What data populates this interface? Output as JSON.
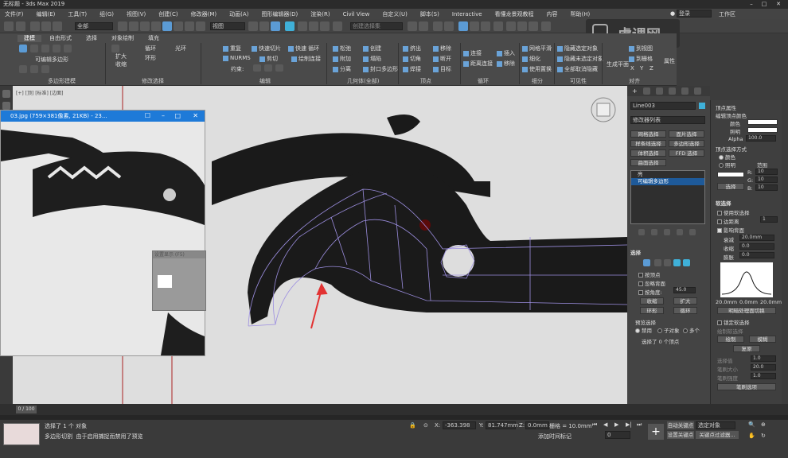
{
  "window": {
    "title": "无标题 - 3ds Max 2019"
  },
  "menu": {
    "items": [
      "文件(F)",
      "编辑(E)",
      "工具(T)",
      "组(G)",
      "视图(V)",
      "创建(C)",
      "修改器(M)",
      "动画(A)",
      "图形编辑器(D)",
      "渲染(R)",
      "Civil View",
      "自定义(U)",
      "脚本(S)",
      "Interactive",
      "看懂龙景观教程",
      "内容",
      "帮助(H)"
    ],
    "login": "登录",
    "workspace": "工作区"
  },
  "toolbar": {
    "filter_value": "全部",
    "view_value": "视图",
    "selection_set_placeholder": "创建选择集"
  },
  "ribbon": {
    "tabs": [
      "建模",
      "自由形式",
      "选择",
      "对象绘制",
      "填充"
    ],
    "active_tab": "建模",
    "polygon_modeling_label": "多边形建模",
    "editable_poly_label": "可编辑多边形",
    "modify_selection": {
      "label": "修改选择",
      "items": [
        "扩大",
        "收缩",
        "循环",
        "环形",
        "光环"
      ]
    },
    "edit": {
      "label": "编辑",
      "items": [
        "重复",
        "快速切片",
        "快速 循环",
        "NURMS",
        "剪切",
        "绘制连接",
        "约束:"
      ]
    },
    "geometry": {
      "label": "几何体(全部)",
      "items": [
        "松弛",
        "创建",
        "附加",
        "塌陷",
        "分离",
        "封口多边形"
      ]
    },
    "vertices": {
      "label": "顶点",
      "items": [
        "挤出",
        "移除",
        "切角",
        "断开",
        "焊接",
        "目标"
      ]
    },
    "loops": {
      "label": "循环",
      "items": [
        "连接",
        "插入",
        "距离连接",
        "移除"
      ]
    },
    "subdivision": {
      "label": "细分",
      "items": [
        "网格平滑",
        "细化",
        "使用置换"
      ]
    },
    "visibility": {
      "label": "可见性",
      "items": [
        "隐藏选定对象",
        "隐藏未选定对象",
        "全部取消隐藏"
      ]
    },
    "align": {
      "label": "对齐",
      "items": [
        "生成平面",
        "到视图",
        "到栅格",
        "X",
        "Y",
        "Z"
      ]
    },
    "properties_label": "属性"
  },
  "viewport": {
    "label": "[+] [顶] [标准] [边面]"
  },
  "image_viewer": {
    "title": "03.jpg  (759×381像素, 21KB) - 23..."
  },
  "mini_panel": {
    "title": "设置显示 (F5)"
  },
  "command_panel": {
    "object_name": "Line003",
    "modifier_list_label": "修改器列表",
    "buttons": [
      "网格选择",
      "面片选择",
      "样条线选择",
      "多边形选择",
      "体积选择",
      "FFD 选择",
      "曲面选择"
    ],
    "stack": [
      "亮",
      "可编辑多边形"
    ],
    "selection_rollout": "选择",
    "by_vertex": "按顶点",
    "ignore_backfacing": "忽略背面",
    "angle_label": "按角度:",
    "angle_value": "45.0",
    "shrink": "收缩",
    "grow": "扩大",
    "ring": "环形",
    "loop": "循环",
    "preview_selection": "预览选择",
    "preview_options": [
      "禁用",
      "子对象",
      "多个"
    ],
    "status": "选择了 0 个顶点"
  },
  "rollout": {
    "vertex_props": "顶点属性",
    "edit_vertex_color": "编辑顶点颜色",
    "color_label": "颜色",
    "illum_label": "照明",
    "alpha_label": "Alpha",
    "alpha_value": "100.0",
    "select_by_vertex_color": "顶点选择方式",
    "color_radio": "颜色",
    "illum_radio": "照明",
    "range_label": "范围",
    "r_label": "R:",
    "g_label": "G:",
    "b_label": "B:",
    "range_value": "10",
    "select_btn": "选择",
    "soft_selection": "软选择",
    "use_soft_selection": "使用软选择",
    "edge_distance": "边距离",
    "edge_distance_value": "1",
    "affect_backfacing": "影响背面",
    "falloff_label": "衰减",
    "falloff_value": "20.0mm",
    "pinch_label": "收缩",
    "pinch_value": "0.0",
    "bubble_label": "膨胀",
    "bubble_value": "0.0",
    "curve_left": "20.0mm",
    "curve_mid": "0.0mm",
    "curve_right": "20.0mm",
    "shaded_face_toggle": "明暗处理面切换",
    "lock_soft_selection": "锁定软选择",
    "paint_soft_selection": "绘制软选择",
    "paint_btn": "绘制",
    "blur_btn": "模糊",
    "revert_btn": "复原",
    "selection_value_label": "选择值",
    "selection_value": "1.0",
    "brush_size_label": "笔刷大小",
    "brush_size_value": "20.0",
    "brush_strength_label": "笔刷强度",
    "brush_strength_value": "1.0",
    "brush_options": "笔刷选项"
  },
  "timeline": {
    "frame_label": "0 / 100"
  },
  "statusbar": {
    "selected_text": "选择了 1 个 对象",
    "prompt_text": "由于启用捕捉而禁用了预览",
    "script_label": "多边形切割",
    "x_value": "-363.398",
    "y_value": "81.747mm",
    "z_value": "0.0mm",
    "grid_label": "栅格 = 10.0mm",
    "add_time_tag": "添加时间标记",
    "auto_key": "自动关键点",
    "selected_object": "选定对象",
    "set_key": "设置关键点",
    "key_filter": "关键点过滤器...",
    "frame_value": "0"
  }
}
